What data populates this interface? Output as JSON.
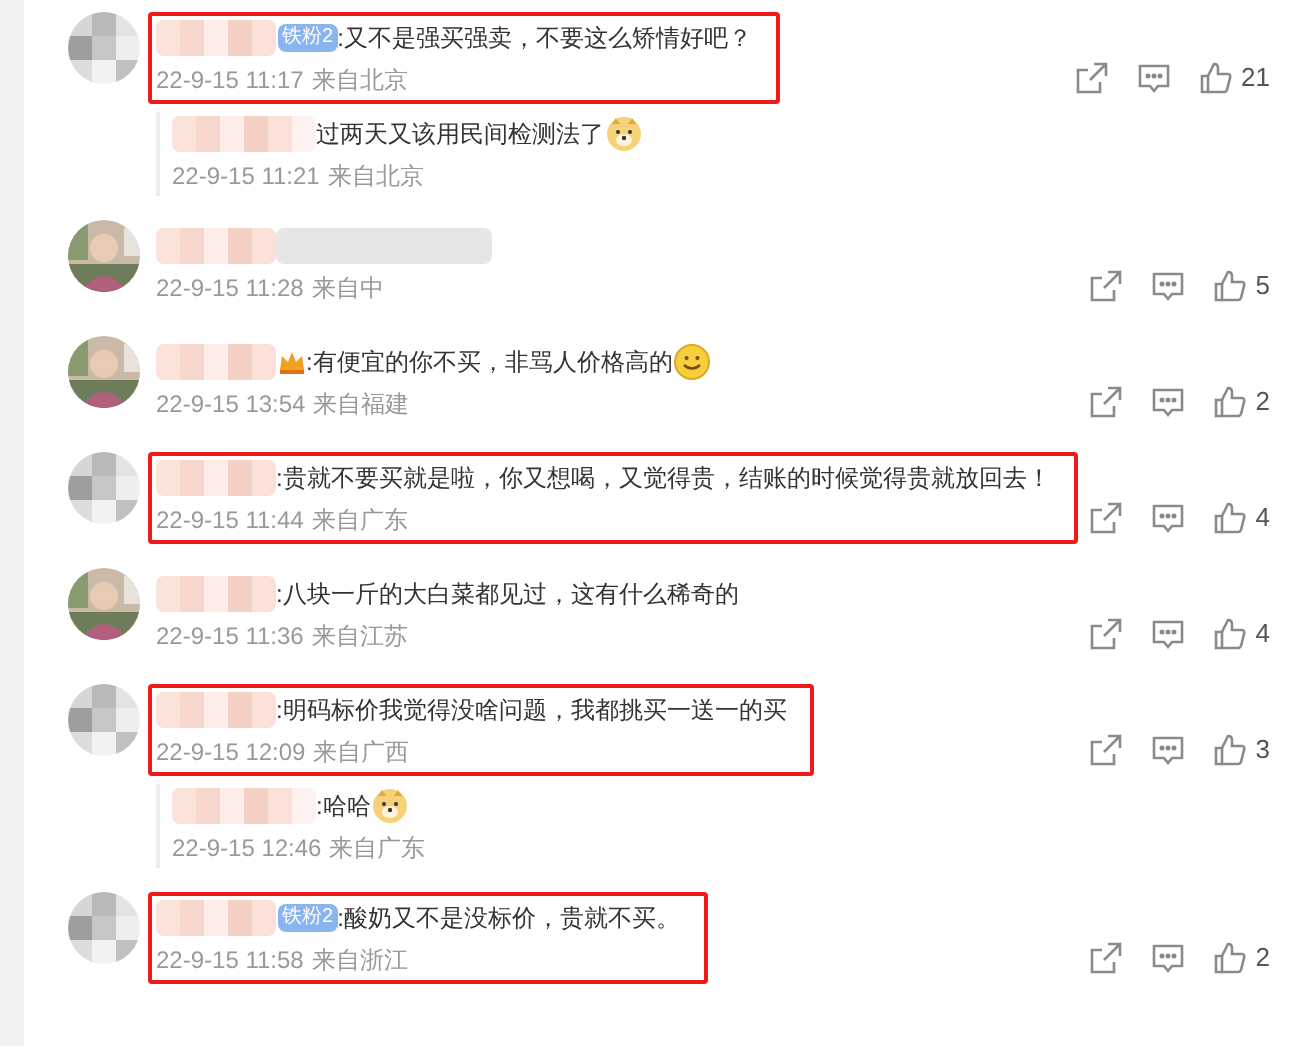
{
  "comments": [
    {
      "avatar": {
        "kind": "blurred"
      },
      "badge": "铁粉2",
      "text": ":又不是强买强卖，不要这么矫情好吧？",
      "time": "22-9-15 11:17",
      "location": "来自北京",
      "likes": "21",
      "highlighted": true,
      "replies": [
        {
          "text": "过两天又该用民间检测法了",
          "emoji": {
            "kind": "doge"
          },
          "time": "22-9-15 11:21",
          "location": "来自北京"
        }
      ]
    },
    {
      "time": "22-9-15 11:28",
      "location": "来自中",
      "likes": "5",
      "highlighted": false
    },
    {
      "crown": true,
      "text": ":有便宜的你不买，非骂人价格高的",
      "emoji": {
        "kind": "smile"
      },
      "time": "22-9-15 13:54",
      "location": "来自福建",
      "likes": "2",
      "highlighted": false
    },
    {
      "avatar": {
        "kind": "blurred"
      },
      "text": ":贵就不要买就是啦，你又想喝，又觉得贵，结账的时候觉得贵就放回去！",
      "time": "22-9-15 11:44",
      "location": "来自广东",
      "likes": "4",
      "highlighted": true
    },
    {
      "text": ":八块一斤的大白菜都见过，这有什么稀奇的",
      "time": "22-9-15 11:36",
      "location": "来自江苏",
      "likes": "4",
      "highlighted": false
    },
    {
      "avatar": {
        "kind": "blurred"
      },
      "text": ":明码标价我觉得没啥问题，我都挑买一送一的买",
      "time": "22-9-15 12:09",
      "location": "来自广西",
      "likes": "3",
      "highlighted": true,
      "replies": [
        {
          "text": ":哈哈",
          "emoji": {
            "kind": "doge"
          },
          "time": "22-9-15 12:46",
          "location": "来自广东"
        }
      ]
    },
    {
      "avatar": {
        "kind": "blurred"
      },
      "badge": "铁粉2",
      "text": ":酸奶又不是没标价，贵就不买。",
      "time": "22-9-15 11:58",
      "location": "来自浙江",
      "likes": "2",
      "highlighted": true
    }
  ]
}
